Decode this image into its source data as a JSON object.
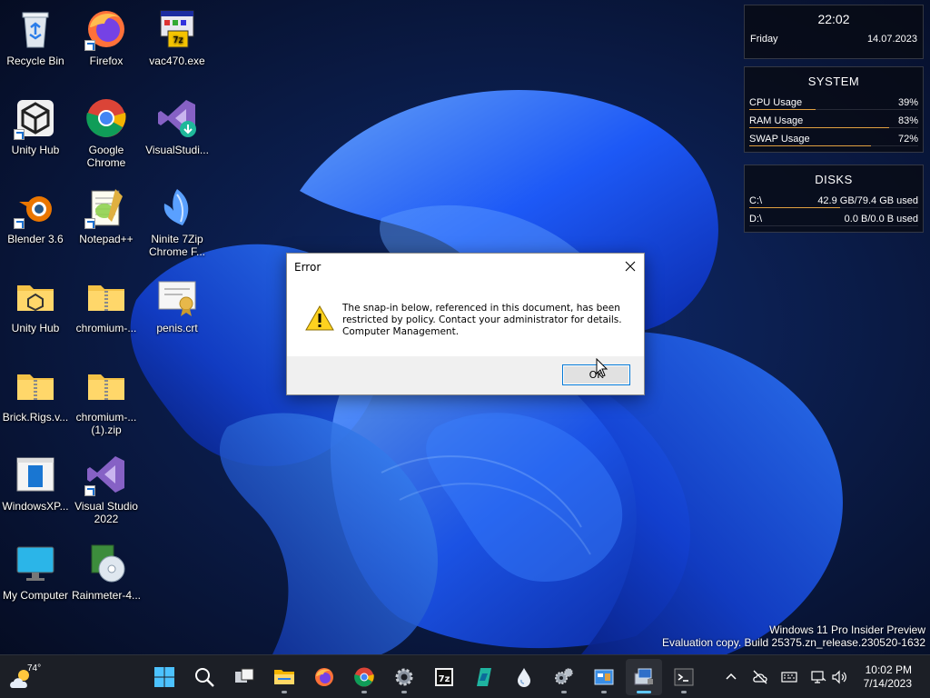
{
  "desktop": {
    "icons": [
      {
        "label": "Recycle Bin",
        "icon": "recycle-bin-icon"
      },
      {
        "label": "Firefox",
        "icon": "firefox-icon"
      },
      {
        "label": "vac470.exe",
        "icon": "installer-icon"
      },
      {
        "label": "Unity Hub",
        "icon": "unity-icon"
      },
      {
        "label": "Google Chrome",
        "icon": "chrome-icon"
      },
      {
        "label": "VisualStudi...",
        "icon": "visual-studio-installer-icon"
      },
      {
        "label": "Blender 3.6",
        "icon": "blender-icon"
      },
      {
        "label": "Notepad++",
        "icon": "notepad-plus-plus-icon"
      },
      {
        "label": "Ninite 7Zip Chrome F...",
        "icon": "ninite-icon"
      },
      {
        "label": "Unity Hub",
        "icon": "unity-folder-icon"
      },
      {
        "label": "chromium-...",
        "icon": "zip-folder-icon"
      },
      {
        "label": "penis.crt",
        "icon": "certificate-icon"
      },
      {
        "label": "Brick.Rigs.v...",
        "icon": "zip-folder-icon"
      },
      {
        "label": "chromium-... (1).zip",
        "icon": "zip-folder-icon"
      },
      {
        "label": "WindowsXP...",
        "icon": "window-app-icon"
      },
      {
        "label": "Visual Studio 2022",
        "icon": "visual-studio-icon"
      },
      {
        "label": "My Computer",
        "icon": "monitor-icon"
      },
      {
        "label": "Rainmeter-4...",
        "icon": "setup-cd-icon"
      }
    ]
  },
  "widgets": {
    "clock": {
      "time": "22:02",
      "day": "Friday",
      "date": "14.07.2023"
    },
    "system": {
      "title": "SYSTEM",
      "rows": [
        {
          "label": "CPU Usage",
          "value": "39%",
          "fraction": 0.39
        },
        {
          "label": "RAM Usage",
          "value": "83%",
          "fraction": 0.83
        },
        {
          "label": "SWAP Usage",
          "value": "72%",
          "fraction": 0.72
        }
      ]
    },
    "disks": {
      "title": "DISKS",
      "rows": [
        {
          "label": "C:\\",
          "value": "42.9 GB/79.4 GB used",
          "fraction": 0.54
        },
        {
          "label": "D:\\",
          "value": "0.0 B/0.0 B used",
          "fraction": 0.0
        }
      ]
    }
  },
  "dialog": {
    "title": "Error",
    "message_lines": [
      "The snap-in below, referenced in this document, has been",
      "restricted by policy. Contact your administrator for details.",
      "Computer Management."
    ],
    "ok_label": "OK",
    "icon": "warning-icon"
  },
  "watermark": {
    "line1": "Windows 11 Pro Insider Preview",
    "line2": "Evaluation copy. Build 25375.zn_release.230520-1632"
  },
  "taskbar": {
    "weather_temp": "74°",
    "apps": [
      {
        "name": "start",
        "icon": "windows-start-icon"
      },
      {
        "name": "search",
        "icon": "search-icon"
      },
      {
        "name": "task-view",
        "icon": "task-view-icon"
      },
      {
        "name": "file-explorer",
        "icon": "folder-icon"
      },
      {
        "name": "firefox",
        "icon": "firefox-icon"
      },
      {
        "name": "chrome",
        "icon": "chrome-icon"
      },
      {
        "name": "settings",
        "icon": "gear-icon"
      },
      {
        "name": "7zip",
        "icon": "seven-zip-icon"
      },
      {
        "name": "azure",
        "icon": "azure-icon"
      },
      {
        "name": "rainmeter",
        "icon": "droplet-icon"
      },
      {
        "name": "services",
        "icon": "gears-icon"
      },
      {
        "name": "control-panel",
        "icon": "control-panel-icon"
      },
      {
        "name": "computer-management",
        "icon": "computer-management-icon"
      },
      {
        "name": "terminal",
        "icon": "terminal-icon"
      }
    ],
    "tray_time": "10:02 PM",
    "tray_date": "7/14/2023"
  },
  "colors": {
    "accent": "#0078d7",
    "widget_bar": "#e0a040",
    "taskbar": "#1c1f26"
  }
}
